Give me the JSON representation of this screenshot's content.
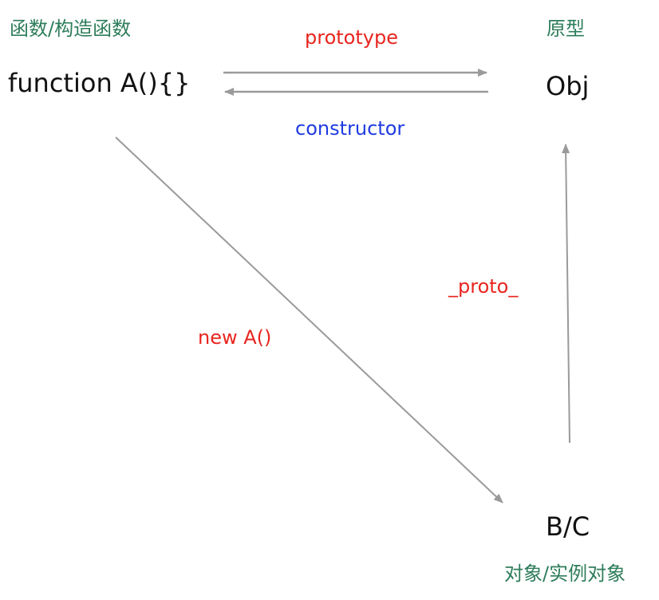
{
  "nodes": {
    "function_caption": "函数/构造函数",
    "function_label": "function A(){}",
    "prototype_caption": "原型",
    "prototype_label": "Obj",
    "instance_label": "B/C",
    "instance_caption": "对象/实例对象"
  },
  "edges": {
    "prototype": "prototype",
    "constructor": "constructor",
    "new_instance": "new A()",
    "proto": "_proto_"
  },
  "colors": {
    "caption": "#2e7d5b",
    "node_text": "#111111",
    "prototype_label": "#e8251f",
    "constructor_label": "#1f3be0",
    "new_label": "#e8251f",
    "proto_label": "#e8251f",
    "arrow": "#9a9a9a"
  }
}
